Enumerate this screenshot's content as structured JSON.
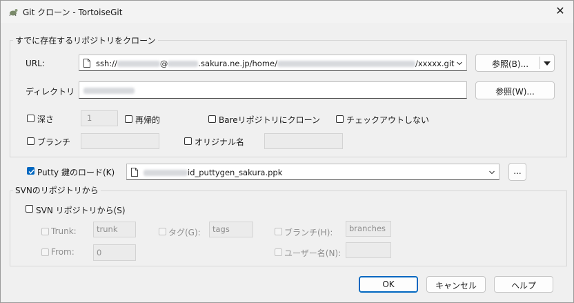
{
  "window": {
    "title": "Git クローン - TortoiseGit",
    "close_glyph": "✕"
  },
  "clone_group": {
    "label": "すでに存在するリポジトリをクローン"
  },
  "url": {
    "label": "URL:",
    "prefix": "ssh://",
    "at": "@",
    "host": ".sakura.ne.jp/home/",
    "suffix": "/xxxxx.git",
    "browse_label": "参照(B)..."
  },
  "directory": {
    "label": "ディレクトリ",
    "browse_label": "参照(W)..."
  },
  "depth": {
    "label": "深さ",
    "value": "1"
  },
  "recursive": {
    "label": "再帰的"
  },
  "bare": {
    "label": "Bareリポジトリにクローン"
  },
  "no_checkout": {
    "label": "チェックアウトしない"
  },
  "branch": {
    "label": "ブランチ"
  },
  "origin": {
    "label": "オリジナル名"
  },
  "putty": {
    "label": "Putty 鍵のロード(K)",
    "file": "id_puttygen_sakura.ppk",
    "browse_label": "..."
  },
  "svn_group": {
    "label": "SVNのリポジトリから"
  },
  "svn": {
    "from_label": "SVN リポジトリから(S)",
    "trunk_label": "Trunk:",
    "trunk_value": "trunk",
    "tags_label": "タグ(G):",
    "tags_value": "tags",
    "branches_label": "ブランチ(H):",
    "branches_value": "branches",
    "from_rev_label": "From:",
    "from_rev_value": "0",
    "username_label": "ユーザー名(N):"
  },
  "buttons": {
    "ok": "OK",
    "cancel": "キャンセル",
    "help": "ヘルプ"
  }
}
